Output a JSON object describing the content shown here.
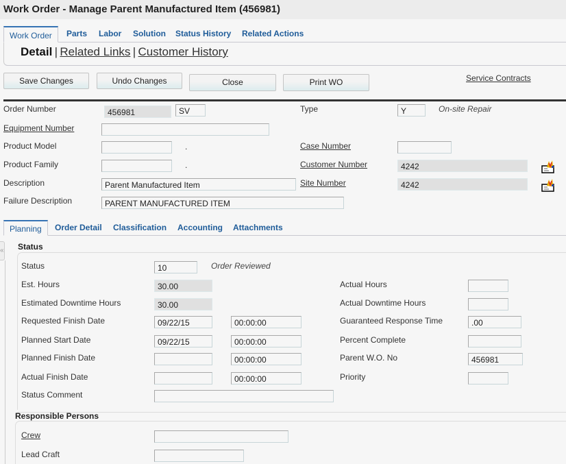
{
  "window": {
    "title": "Work Order - Manage Parent Manufactured Item (456981)"
  },
  "top_tabs": [
    {
      "label": "Work Order",
      "active": true
    },
    {
      "label": "Parts"
    },
    {
      "label": "Labor"
    },
    {
      "label": "Solution"
    },
    {
      "label": "Status History"
    },
    {
      "label": "Related Actions"
    }
  ],
  "subnav": {
    "detail": "Detail",
    "sep": "|",
    "related_links": "Related Links",
    "customer_history": "Customer History"
  },
  "toolbar": {
    "save": "Save Changes",
    "undo": "Undo Changes",
    "close": "Close",
    "print": "Print WO",
    "service_contracts": "Service Contracts"
  },
  "header_form": {
    "order_number": {
      "label": "Order Number",
      "value": "456981",
      "type_code": "SV"
    },
    "type": {
      "label": "Type",
      "value": "Y",
      "description": "On-site Repair"
    },
    "equipment_number": {
      "label": "Equipment Number",
      "value": ""
    },
    "product_model": {
      "label": "Product Model",
      "value": "",
      "suffix": "."
    },
    "product_family": {
      "label": "Product Family",
      "value": "",
      "suffix": "."
    },
    "case_number": {
      "label": "Case Number",
      "value": ""
    },
    "customer_number": {
      "label": "Customer Number",
      "value": "4242",
      "icon": "address-book-lookup-icon"
    },
    "site_number": {
      "label": "Site Number",
      "value": "4242",
      "icon": "address-book-lookup-icon"
    },
    "description": {
      "label": "Description",
      "value": "Parent Manufactured Item"
    },
    "failure_description": {
      "label": "Failure Description",
      "value": "PARENT MANUFACTURED ITEM"
    }
  },
  "detail_tabs": [
    {
      "label": "Planning",
      "active": true
    },
    {
      "label": "Order Detail"
    },
    {
      "label": "Classification"
    },
    {
      "label": "Accounting"
    },
    {
      "label": "Attachments"
    }
  ],
  "collapse_glyph": "«",
  "status_section": {
    "heading": "Status",
    "status": {
      "label": "Status",
      "value": "10",
      "description": "Order Reviewed"
    },
    "est_hours": {
      "label": "Est. Hours",
      "value": "30.00"
    },
    "est_downtime_hours": {
      "label": "Estimated Downtime Hours",
      "value": "30.00"
    },
    "requested_finish_date": {
      "label": "Requested Finish Date",
      "date": "09/22/15",
      "time": "00:00:00"
    },
    "planned_start_date": {
      "label": "Planned Start Date",
      "date": "09/22/15",
      "time": "00:00:00"
    },
    "planned_finish_date": {
      "label": "Planned Finish Date",
      "date": "",
      "time": "00:00:00"
    },
    "actual_finish_date": {
      "label": "Actual Finish Date",
      "date": "",
      "time": "00:00:00"
    },
    "status_comment": {
      "label": "Status Comment",
      "value": ""
    },
    "actual_hours": {
      "label": "Actual Hours",
      "value": ""
    },
    "actual_downtime_hours": {
      "label": "Actual Downtime Hours",
      "value": ""
    },
    "guaranteed_response_time": {
      "label": "Guaranteed Response Time",
      "value": ".00"
    },
    "percent_complete": {
      "label": "Percent Complete",
      "value": ""
    },
    "parent_wo_no": {
      "label": "Parent W.O. No",
      "value": "456981"
    },
    "priority": {
      "label": "Priority",
      "value": ""
    }
  },
  "responsible_section": {
    "heading": "Responsible Persons",
    "crew": {
      "label": "Crew",
      "value": ""
    },
    "lead_craft": {
      "label": "Lead Craft",
      "value": ""
    }
  }
}
